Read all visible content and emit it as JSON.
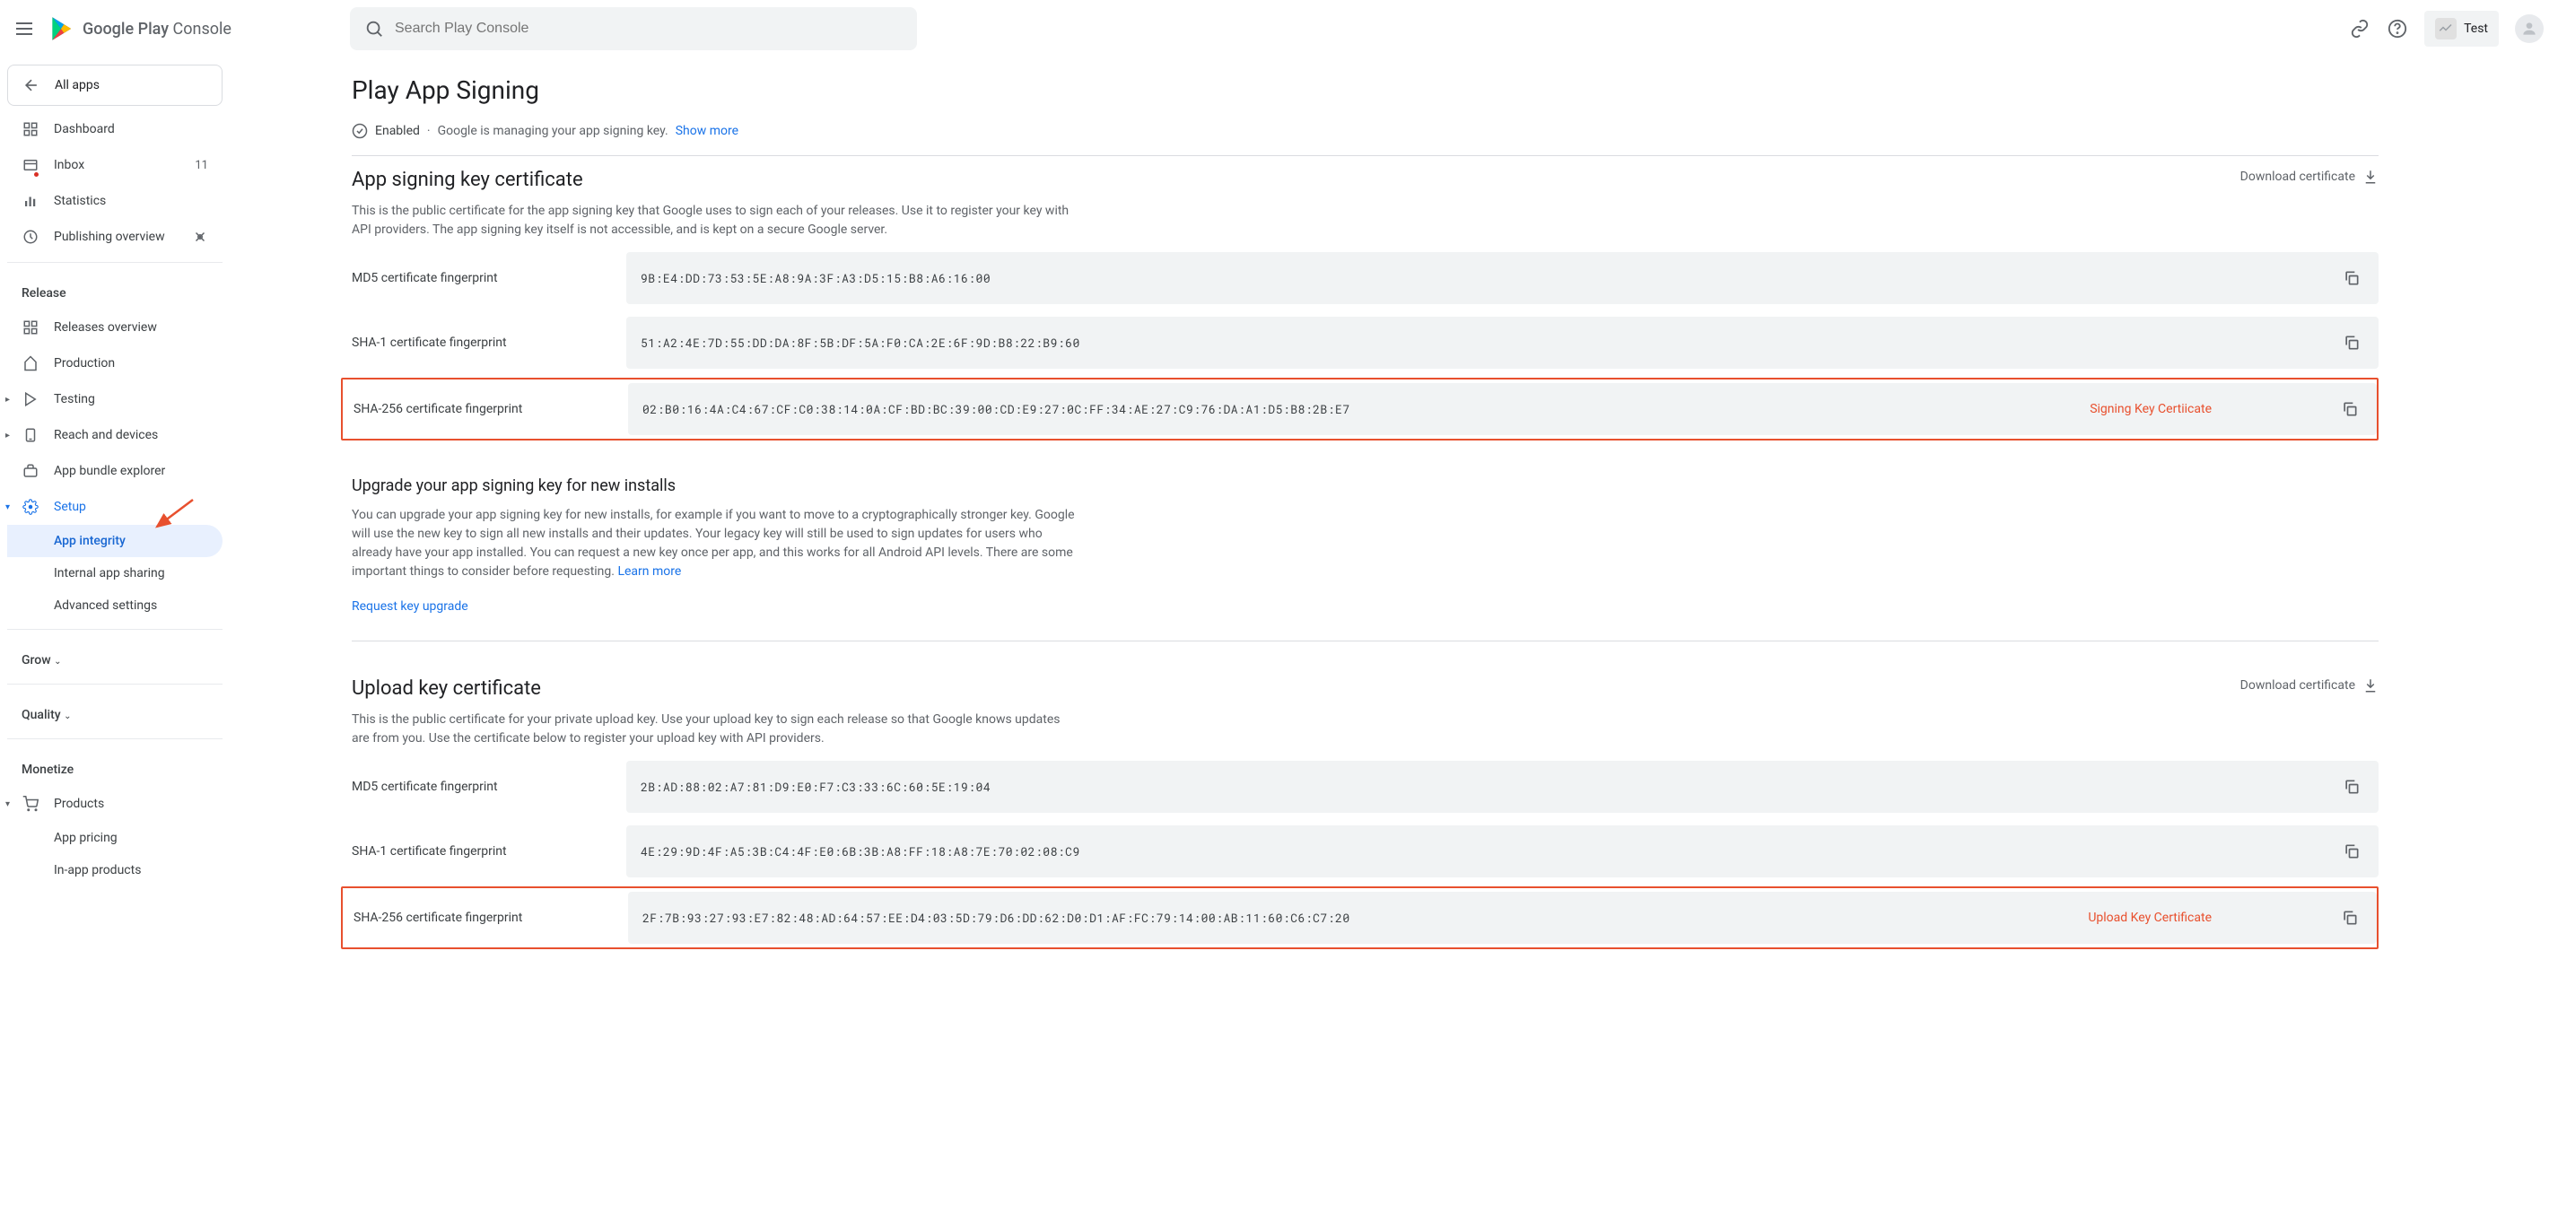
{
  "header": {
    "brand_prefix": "Google Play",
    "brand_suffix": " Console",
    "search_placeholder": "Search Play Console",
    "app_name": "Test"
  },
  "sidebar": {
    "all_apps": "All apps",
    "items": [
      {
        "label": "Dashboard"
      },
      {
        "label": "Inbox",
        "badge": "11"
      },
      {
        "label": "Statistics"
      },
      {
        "label": "Publishing overview"
      }
    ],
    "release_header": "Release",
    "release_items": [
      {
        "label": "Releases overview"
      },
      {
        "label": "Production"
      },
      {
        "label": "Testing"
      },
      {
        "label": "Reach and devices"
      },
      {
        "label": "App bundle explorer"
      },
      {
        "label": "Setup"
      }
    ],
    "setup_sub": [
      {
        "label": "App integrity"
      },
      {
        "label": "Internal app sharing"
      },
      {
        "label": "Advanced settings"
      }
    ],
    "grow_header": "Grow",
    "quality_header": "Quality",
    "monetize_header": "Monetize",
    "monetize_items": [
      {
        "label": "Products"
      },
      {
        "label": "App pricing"
      },
      {
        "label": "In-app products"
      }
    ]
  },
  "main": {
    "title": "Play App Signing",
    "enabled": "Enabled",
    "status_text": "Google is managing your app signing key.",
    "show_more": "Show more",
    "section1": {
      "title": "App signing key certificate",
      "download": "Download certificate",
      "desc": "This is the public certificate for the app signing key that Google uses to sign each of your releases. Use it to register your key with API providers. The app signing key itself is not accessible, and is kept on a secure Google server.",
      "rows": [
        {
          "label": "MD5 certificate fingerprint",
          "value": "9B:E4:DD:73:53:5E:A8:9A:3F:A3:D5:15:B8:A6:16:00"
        },
        {
          "label": "SHA-1 certificate fingerprint",
          "value": "51:A2:4E:7D:55:DD:DA:8F:5B:DF:5A:F0:CA:2E:6F:9D:B8:22:B9:60"
        },
        {
          "label": "SHA-256 certificate fingerprint",
          "value": "02:B0:16:4A:C4:67:CF:C0:38:14:0A:CF:BD:BC:39:00:CD:E9:27:0C:FF:34:AE:27:C9:76:DA:A1:D5:B8:2B:E7"
        }
      ],
      "annotation": "Signing Key Certiicate"
    },
    "upgrade": {
      "title": "Upgrade your app signing key for new installs",
      "desc": "You can upgrade your app signing key for new installs, for example if you want to move to a cryptographically stronger key. Google will use the new key to sign all new installs and their updates. Your legacy key will still be used to sign updates for users who already have your app installed. You can request a new key once per app, and this works for all Android API levels. There are some important things to consider before requesting.",
      "learn_more": "Learn more",
      "request": "Request key upgrade"
    },
    "section2": {
      "title": "Upload key certificate",
      "download": "Download certificate",
      "desc": "This is the public certificate for your private upload key. Use your upload key to sign each release so that Google knows updates are from you. Use the certificate below to register your upload key with API providers.",
      "rows": [
        {
          "label": "MD5 certificate fingerprint",
          "value": "2B:AD:88:02:A7:81:D9:E0:F7:C3:33:6C:60:5E:19:04"
        },
        {
          "label": "SHA-1 certificate fingerprint",
          "value": "4E:29:9D:4F:A5:3B:C4:4F:E0:6B:3B:A8:FF:18:A8:7E:70:02:08:C9"
        },
        {
          "label": "SHA-256 certificate fingerprint",
          "value": "2F:7B:93:27:93:E7:82:48:AD:64:57:EE:D4:03:5D:79:D6:DD:62:D0:D1:AF:FC:79:14:00:AB:11:60:C6:C7:20"
        }
      ],
      "annotation": "Upload Key Certificate"
    }
  }
}
